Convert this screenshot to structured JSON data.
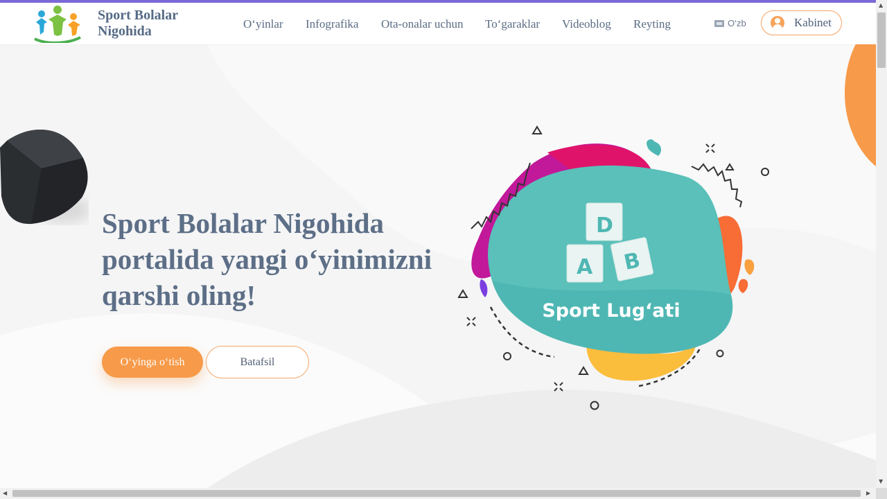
{
  "header": {
    "brand": "Sport Bolalar Nigohida",
    "brand_line1": "Sport Bolalar",
    "brand_line2": "Nigohida",
    "nav": [
      "O‘yinlar",
      "Infografika",
      "Ota-onalar uchun",
      "To‘garaklar",
      "Videoblog",
      "Reyting"
    ],
    "language": "O‘zb",
    "cabinet_label": "Kabinet"
  },
  "hero": {
    "title": "Sport Bolalar Nigohida portalida yangi o‘yinimizni qarshi oling!",
    "primary_button": "O‘yinga o‘tish",
    "secondary_button": "Batafsil",
    "game_name": "Sport Lug‘ati",
    "blocks": [
      "D",
      "A",
      "B"
    ]
  },
  "colors": {
    "accent": "#f79a49",
    "topline": "#7b6ad6",
    "teal": "#4fb7b3",
    "magenta": "#c2189a",
    "text": "#5d6f87"
  },
  "icons": [
    "logo-people-icon",
    "language-icon",
    "user-icon",
    "dark-cube-decoration"
  ]
}
